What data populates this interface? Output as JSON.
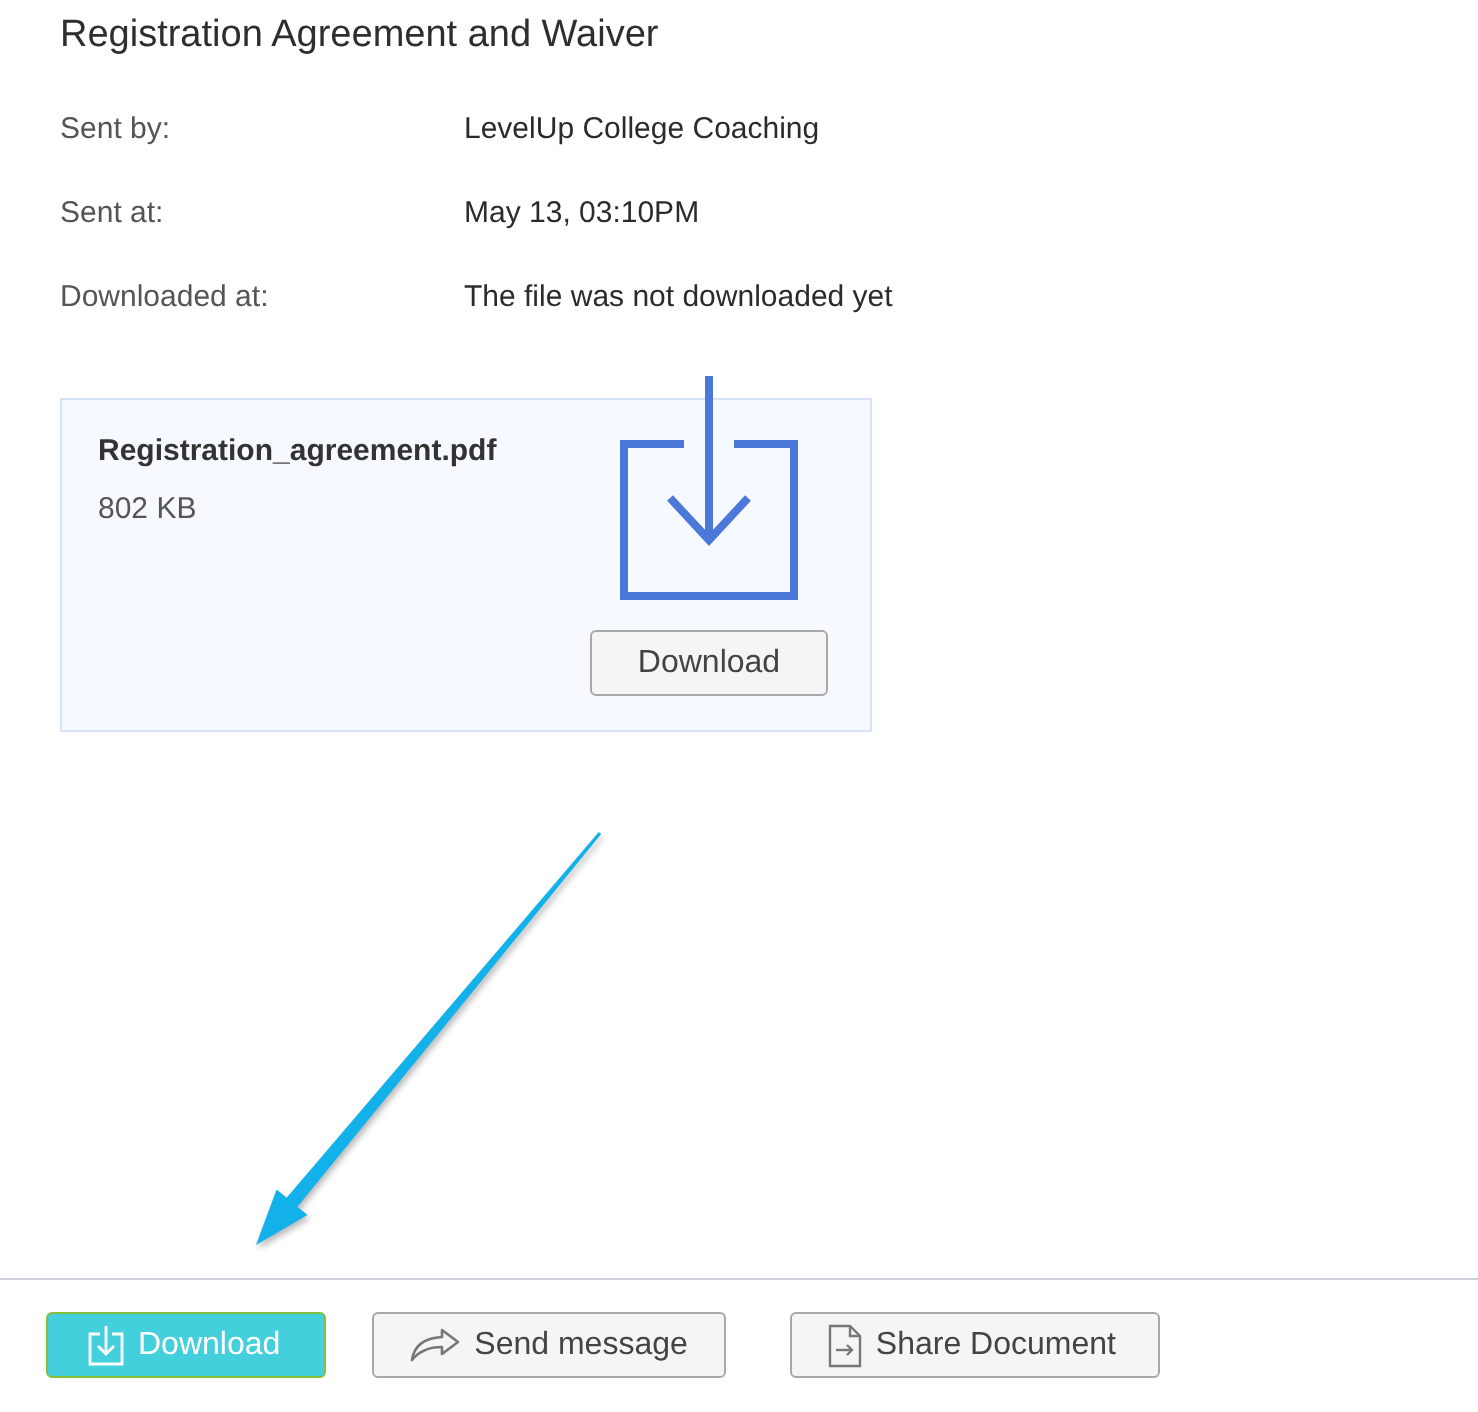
{
  "document": {
    "title": "Registration Agreement and Waiver",
    "details": [
      {
        "label": "Sent by:",
        "value": "LevelUp College Coaching"
      },
      {
        "label": "Sent at:",
        "value": "May 13, 03:10PM"
      },
      {
        "label": "Downloaded at:",
        "value": "The file was not downloaded yet"
      }
    ]
  },
  "attachment": {
    "file_name": "Registration_agreement.pdf",
    "size": "802 KB",
    "button": "Download"
  },
  "actions": [
    {
      "label": "Download",
      "kind": "download"
    },
    {
      "label": "Send message",
      "kind": "send"
    },
    {
      "label": "Share Document",
      "kind": "share"
    }
  ]
}
